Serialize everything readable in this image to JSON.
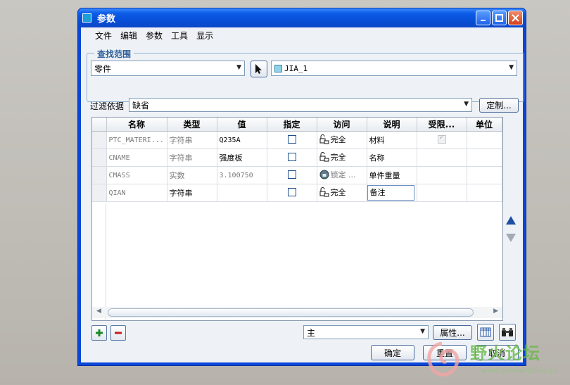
{
  "window": {
    "title": "参数"
  },
  "menu": [
    "文件",
    "编辑",
    "参数",
    "工具",
    "显示"
  ],
  "lookup": {
    "group_label": "查找范围",
    "scope_value": "零件",
    "object_value": "JIA_1"
  },
  "filter": {
    "label": "过滤依据",
    "value": "缺省",
    "customize_label": "定制..."
  },
  "table": {
    "columns": [
      "名称",
      "类型",
      "值",
      "指定",
      "访问",
      "说明",
      "受限...",
      "单位"
    ],
    "rows": [
      {
        "name": "PTC_MATERI...",
        "type": "字符串",
        "value": "Q235A",
        "designate": false,
        "access": "完全",
        "desc": "材料",
        "restricted": true
      },
      {
        "name": "CNAME",
        "type": "字符串",
        "value": "强度板",
        "designate": false,
        "access": "完全",
        "desc": "名称",
        "restricted": false
      },
      {
        "name": "CMASS",
        "type": "实数",
        "value": "3.100750",
        "designate": false,
        "access": "锁定 ...",
        "desc": "单件重量",
        "restricted": false
      },
      {
        "name": "QIAN",
        "type": "字符串",
        "value": "",
        "designate": false,
        "access": "完全",
        "desc": "备注",
        "restricted": false
      }
    ]
  },
  "bottom": {
    "view_value": "主",
    "properties_label": "属性...",
    "ok_label": "确定",
    "reset_label": "重置",
    "cancel_label": "取消"
  },
  "watermark": {
    "text": "野火论坛",
    "url": "www.proewildfire.cn"
  },
  "colors": {
    "titlebar": "#0a46d8",
    "accent": "#2f5f9a",
    "add": "#1c8a2a",
    "remove": "#c81e1e"
  }
}
